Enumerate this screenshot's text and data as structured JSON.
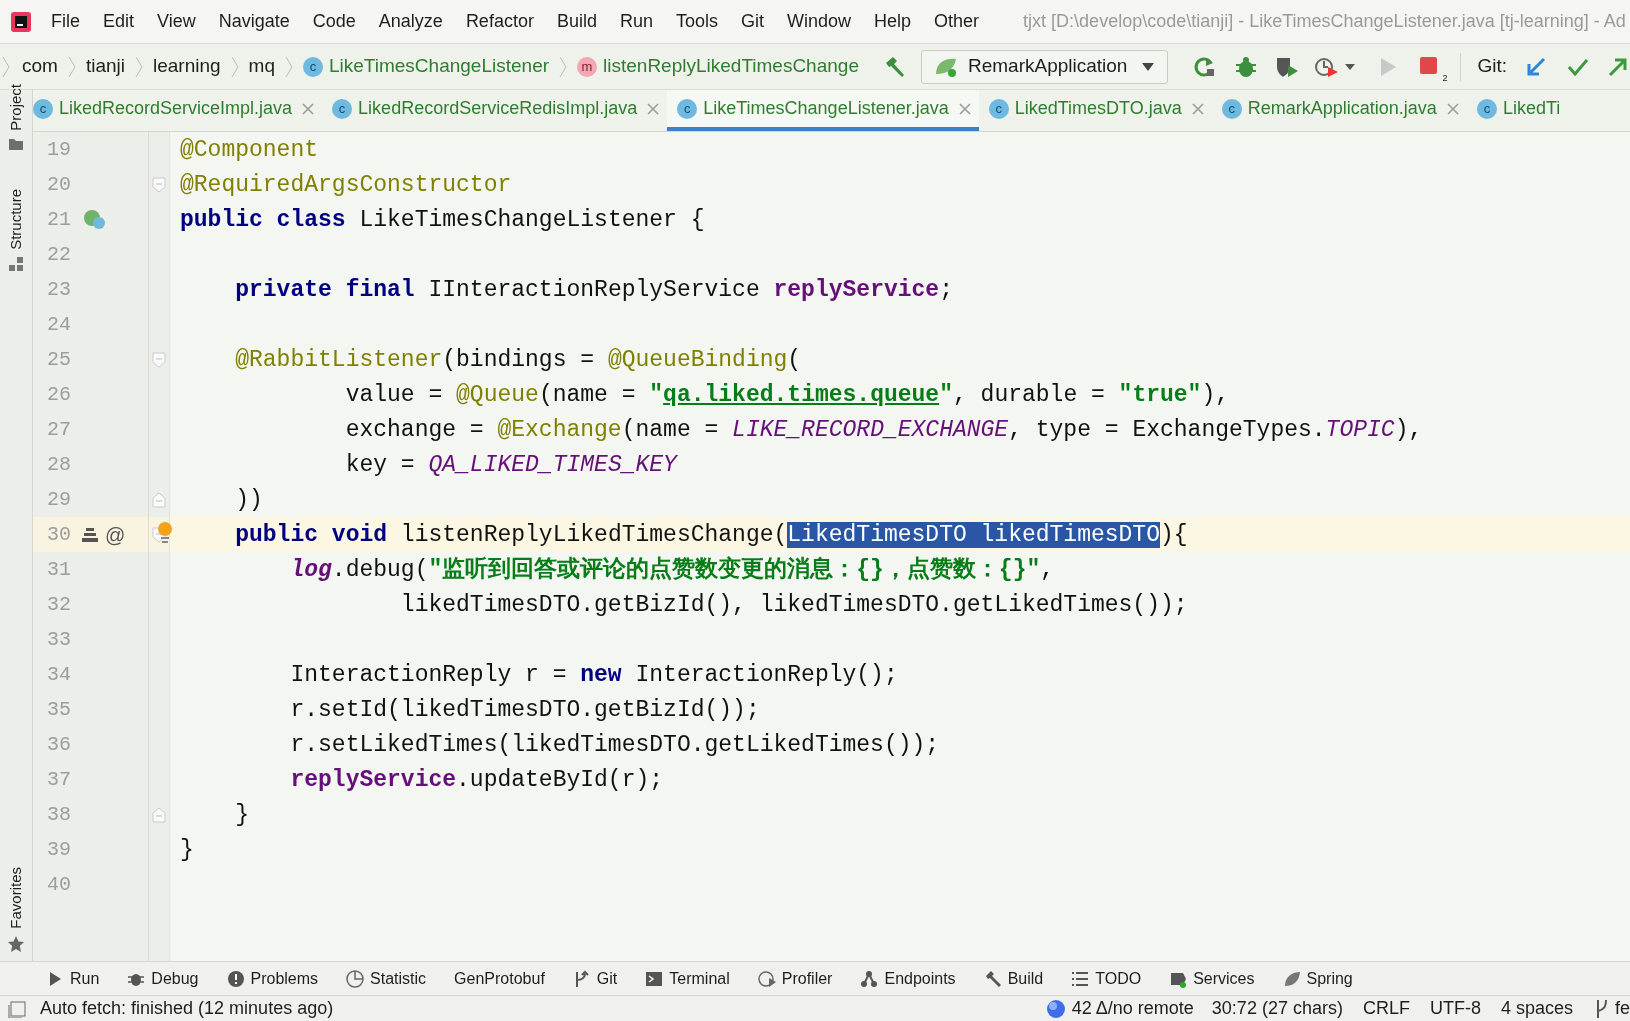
{
  "menu": [
    "File",
    "Edit",
    "View",
    "Navigate",
    "Code",
    "Analyze",
    "Refactor",
    "Build",
    "Run",
    "Tools",
    "Git",
    "Window",
    "Help",
    "Other"
  ],
  "window": {
    "title": "tjxt [D:\\develop\\code\\tianji] - LikeTimesChangeListener.java [tj-learning] - Ad"
  },
  "breadcrumbs": [
    {
      "label": "com",
      "kind": "package"
    },
    {
      "label": "tianji",
      "kind": "package"
    },
    {
      "label": "learning",
      "kind": "package"
    },
    {
      "label": "mq",
      "kind": "package"
    },
    {
      "label": "LikeTimesChangeListener",
      "kind": "class",
      "badge": "c"
    },
    {
      "label": "listenReplyLikedTimesChange",
      "kind": "method",
      "badge": "m"
    }
  ],
  "toolbar": {
    "run_config": "RemarkApplication",
    "stop_badge": "2",
    "git_label": "Git:"
  },
  "side_tools": {
    "top": [
      "Project",
      "Structure"
    ],
    "bottom": [
      "Favorites"
    ]
  },
  "tabs": [
    {
      "label": "LikedRecordServiceImpl.java",
      "badge": "c",
      "selected": false
    },
    {
      "label": "LikedRecordServiceRedisImpl.java",
      "badge": "c",
      "selected": false
    },
    {
      "label": "LikeTimesChangeListener.java",
      "badge": "c",
      "selected": true
    },
    {
      "label": "LikedTimesDTO.java",
      "badge": "c",
      "selected": false
    },
    {
      "label": "RemarkApplication.java",
      "badge": "c",
      "selected": false
    },
    {
      "label": "LikedTi",
      "badge": "c",
      "selected": false
    }
  ],
  "lines": [
    {
      "number": "19",
      "tokens": [
        {
          "kind": "annotation",
          "text": "@Component"
        }
      ]
    },
    {
      "number": "20",
      "fold_start": true,
      "tokens": [
        {
          "kind": "annotation",
          "text": "@RequiredArgsConstructor"
        }
      ]
    },
    {
      "number": "21",
      "gutter_icons": [
        {
          "kind": "bean"
        }
      ],
      "tokens": [
        {
          "kind": "keyword",
          "text": "public class "
        },
        {
          "kind": "plain",
          "text": "LikeTimesChangeListener {"
        }
      ]
    },
    {
      "number": "22"
    },
    {
      "number": "23",
      "tokens": [
        {
          "kind": "keyword",
          "text": "    private final "
        },
        {
          "kind": "plain",
          "text": "IInteractionReplyService "
        },
        {
          "kind": "field",
          "text": "replyService"
        },
        {
          "kind": "plain",
          "text": ";"
        }
      ]
    },
    {
      "number": "24"
    },
    {
      "number": "25",
      "fold_start": true,
      "tokens": [
        {
          "kind": "annotation",
          "text": "    @RabbitListener"
        },
        {
          "kind": "plain",
          "text": "(bindings = "
        },
        {
          "kind": "annotation",
          "text": "@QueueBinding"
        },
        {
          "kind": "plain",
          "text": "("
        }
      ]
    },
    {
      "number": "26",
      "tokens": [
        {
          "kind": "plain",
          "text": "            value = "
        },
        {
          "kind": "annotation",
          "text": "@Queue"
        },
        {
          "kind": "plain",
          "text": "(name = "
        },
        {
          "kind": "string",
          "text": "\""
        },
        {
          "kind": "link",
          "text": "qa.liked.times.queue"
        },
        {
          "kind": "string",
          "text": "\""
        },
        {
          "kind": "plain",
          "text": ", durable = "
        },
        {
          "kind": "string",
          "text": "\"true\""
        },
        {
          "kind": "plain",
          "text": "),"
        }
      ]
    },
    {
      "number": "27",
      "tokens": [
        {
          "kind": "plain",
          "text": "            exchange = "
        },
        {
          "kind": "annotation",
          "text": "@Exchange"
        },
        {
          "kind": "plain",
          "text": "(name = "
        },
        {
          "kind": "static",
          "text": "LIKE_RECORD_EXCHANGE"
        },
        {
          "kind": "plain",
          "text": ", type = ExchangeTypes."
        },
        {
          "kind": "static",
          "text": "TOPIC"
        },
        {
          "kind": "plain",
          "text": "),"
        }
      ]
    },
    {
      "number": "28",
      "tokens": [
        {
          "kind": "plain",
          "text": "            key = "
        },
        {
          "kind": "static",
          "text": "QA_LIKED_TIMES_KEY"
        }
      ]
    },
    {
      "number": "29",
      "fold_end": true,
      "tokens": [
        {
          "kind": "plain",
          "text": "    ))"
        }
      ]
    },
    {
      "number": "30",
      "current": true,
      "fold_start": true,
      "gutter_icons": [
        {
          "kind": "stack"
        }
      ],
      "gutter_text": "@",
      "bulb": true,
      "tokens": [
        {
          "kind": "keyword",
          "text": "    public void "
        },
        {
          "kind": "plain",
          "text": "listenReplyLikedTimesChange("
        },
        {
          "kind": "selected",
          "text": "LikedTimesDTO likedTimesDTO"
        },
        {
          "kind": "plain",
          "text": "){"
        }
      ]
    },
    {
      "number": "31",
      "tokens": [
        {
          "kind": "static_field",
          "text": "        log"
        },
        {
          "kind": "plain",
          "text": ".debug("
        },
        {
          "kind": "string",
          "text": "\"监听到回答或评论的点赞数变更的消息：{}，点赞数：{}\""
        },
        {
          "kind": "plain",
          "text": ","
        }
      ]
    },
    {
      "number": "32",
      "tokens": [
        {
          "kind": "plain",
          "text": "                likedTimesDTO.getBizId(), likedTimesDTO.getLikedTimes());"
        }
      ]
    },
    {
      "number": "33"
    },
    {
      "number": "34",
      "tokens": [
        {
          "kind": "plain",
          "text": "        InteractionReply r = "
        },
        {
          "kind": "keyword",
          "text": "new "
        },
        {
          "kind": "plain",
          "text": "InteractionReply();"
        }
      ]
    },
    {
      "number": "35",
      "tokens": [
        {
          "kind": "plain",
          "text": "        r.setId(likedTimesDTO.getBizId());"
        }
      ]
    },
    {
      "number": "36",
      "tokens": [
        {
          "kind": "plain",
          "text": "        r.setLikedTimes(likedTimesDTO.getLikedTimes());"
        }
      ]
    },
    {
      "number": "37",
      "tokens": [
        {
          "kind": "field",
          "text": "        replyService"
        },
        {
          "kind": "plain",
          "text": ".updateById(r);"
        }
      ]
    },
    {
      "number": "38",
      "fold_end": true,
      "tokens": [
        {
          "kind": "plain",
          "text": "    }"
        }
      ]
    },
    {
      "number": "39",
      "tokens": [
        {
          "kind": "plain",
          "text": "}"
        }
      ]
    },
    {
      "number": "40"
    }
  ],
  "tool_windows": [
    {
      "label": "Run",
      "kind": "run"
    },
    {
      "label": "Debug",
      "kind": "debug"
    },
    {
      "label": "Problems",
      "kind": "problems"
    },
    {
      "label": "Statistic",
      "kind": "statistic"
    },
    {
      "label": "GenProtobuf",
      "kind": "plain"
    },
    {
      "label": "Git",
      "kind": "git"
    },
    {
      "label": "Terminal",
      "kind": "terminal"
    },
    {
      "label": "Profiler",
      "kind": "profiler"
    },
    {
      "label": "Endpoints",
      "kind": "endpoints"
    },
    {
      "label": "Build",
      "kind": "build"
    },
    {
      "label": "TODO",
      "kind": "todo"
    },
    {
      "label": "Services",
      "kind": "services"
    },
    {
      "label": "Spring",
      "kind": "spring"
    }
  ],
  "status_bar": {
    "message": "Auto fetch: finished (12 minutes ago)",
    "changes": "42 Δ/no remote",
    "position": "30:72 (27 chars)",
    "line_separator": "CRLF",
    "encoding": "UTF-8",
    "indent": "4 spaces",
    "branch": "fe"
  }
}
